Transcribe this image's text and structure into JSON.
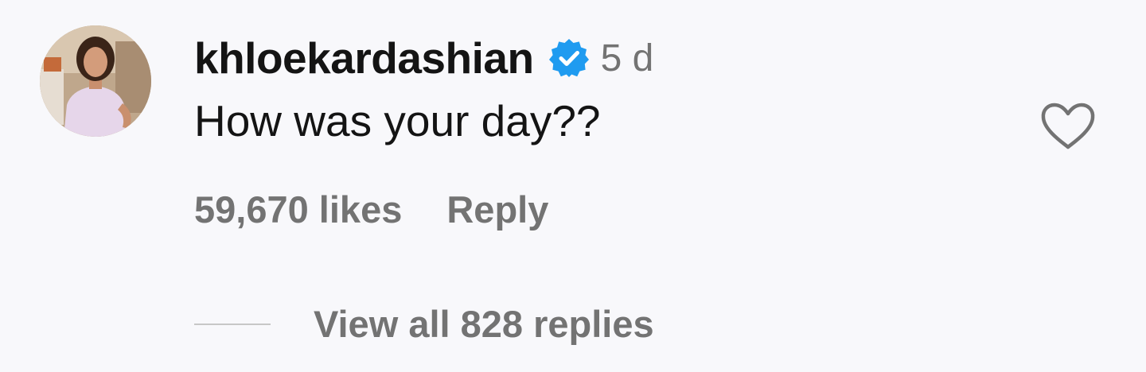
{
  "comment": {
    "username": "khloekardashian",
    "verified_icon": "verified-badge-icon",
    "timestamp": "5 d",
    "text": "How was your day??",
    "likes": "59,670 likes",
    "reply_label": "Reply",
    "view_replies_label": "View all 828 replies",
    "like_icon": "heart-outline-icon"
  },
  "colors": {
    "background": "#f8f8fb",
    "primary_text": "#141414",
    "secondary_text": "#737373",
    "verified_blue": "#1f9bf0"
  }
}
